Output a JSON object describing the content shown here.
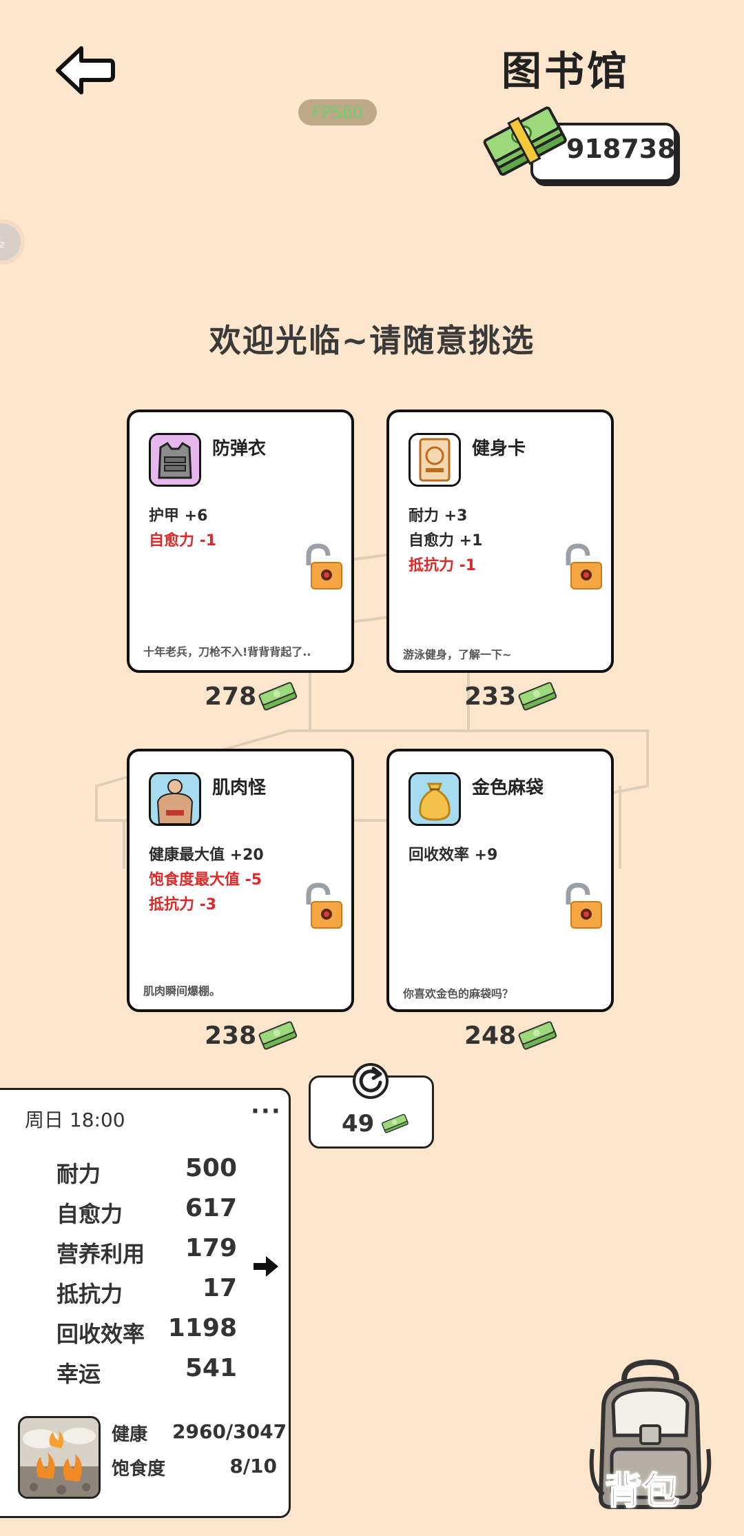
{
  "header": {
    "title": "图书馆",
    "fps": "FPS60",
    "money": "918738",
    "sleep_badge": "zz"
  },
  "welcome": "欢迎光临~请随意挑选",
  "items": [
    {
      "name": "防弹衣",
      "icon": "bulletproof-vest-icon",
      "stats": [
        {
          "text": "护甲 +6",
          "kind": "pos"
        },
        {
          "text": "自愈力 -1",
          "kind": "neg"
        }
      ],
      "desc": "十年老兵，刀枪不入!背背背起了..",
      "price": "278"
    },
    {
      "name": "健身卡",
      "icon": "fitness-card-icon",
      "stats": [
        {
          "text": "耐力 +3",
          "kind": "pos"
        },
        {
          "text": "自愈力 +1",
          "kind": "pos"
        },
        {
          "text": "抵抗力 -1",
          "kind": "neg"
        }
      ],
      "desc": "游泳健身，了解一下~",
      "price": "233"
    },
    {
      "name": "肌肉怪",
      "icon": "muscle-man-icon",
      "stats": [
        {
          "text": "健康最大值 +20",
          "kind": "pos"
        },
        {
          "text": "饱食度最大值 -5",
          "kind": "neg"
        },
        {
          "text": "抵抗力 -3",
          "kind": "neg"
        }
      ],
      "desc": "肌肉瞬间爆棚。",
      "price": "238"
    },
    {
      "name": "金色麻袋",
      "icon": "golden-sack-icon",
      "stats": [
        {
          "text": "回收效率 +9",
          "kind": "pos"
        }
      ],
      "desc": "你喜欢金色的麻袋吗？",
      "price": "248"
    }
  ],
  "refresh": {
    "cost": "49"
  },
  "panel": {
    "time": "周日 18:00",
    "more": "···",
    "stats": [
      {
        "label": "耐力",
        "value": "500"
      },
      {
        "label": "自愈力",
        "value": "617"
      },
      {
        "label": "营养利用",
        "value": "179"
      },
      {
        "label": "抵抗力",
        "value": "17"
      },
      {
        "label": "回收效率",
        "value": "1198"
      },
      {
        "label": "幸运",
        "value": "541"
      }
    ],
    "health_label": "健康",
    "health_value": "2960/3047",
    "satiety_label": "饱食度",
    "satiety_value": "8/10"
  },
  "backpack": {
    "label": "背包"
  },
  "colors": {
    "background": "#fde6cc",
    "negative": "#e02828",
    "money_green": "#8bd36a",
    "fps_green": "#6fd06a"
  }
}
